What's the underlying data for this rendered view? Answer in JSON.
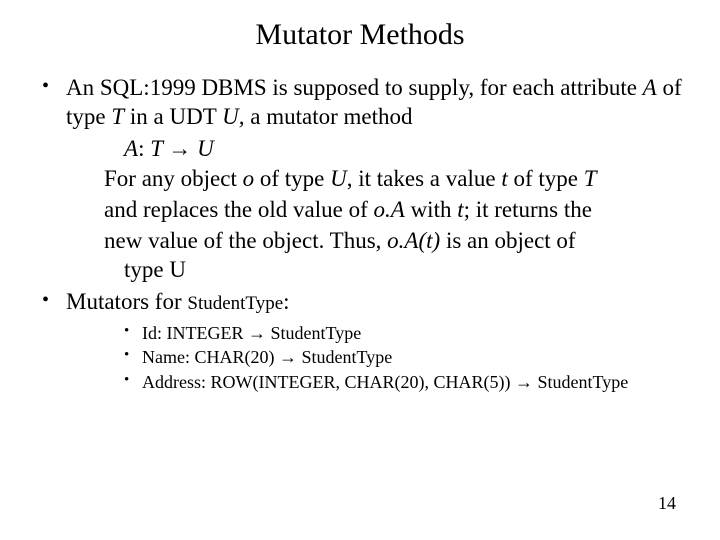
{
  "title": "Mutator Methods",
  "b1": {
    "pre": "An SQL:1999 DBMS is supposed to supply, for each attribute ",
    "A": "A",
    "mid1": " of type ",
    "T": "T",
    "mid2": " in a UDT ",
    "U": "U,",
    "mid3": " a ",
    "mm": "mutator method"
  },
  "sig": {
    "A": "A",
    "colon": ":  ",
    "T": "T ",
    "arrow": "→",
    "sp": "  ",
    "U": "U"
  },
  "para": {
    "p1a": "For any object ",
    "o1": "o",
    "p1b": " of type ",
    "U1": "U",
    "p1c": ", it takes a value ",
    "t1": "t",
    "p1d": " of  type ",
    "T1": "T",
    "p2a": "and replaces the old value of ",
    "oA": "o.A",
    "p2b": " with ",
    "t2": "t",
    "p2c": "; it returns the",
    "p3a": "new value of the object.  Thus, ",
    "oAt": "o.A(t)",
    "p3b": " is an object  of",
    "p4": "type U"
  },
  "b2": {
    "pre": "Mutators for ",
    "stu": "StudentType",
    "post": ":"
  },
  "inner": {
    "i1a": "Id:  INTEGER ",
    "i1b": " StudentType",
    "i2a": "Name: CHAR(20) ",
    "i2b": " StudentType",
    "i3a": "Address: ROW(INTEGER, CHAR(20), CHAR(5)) ",
    "i3b": " StudentType",
    "arrow": "→"
  },
  "page": "14"
}
